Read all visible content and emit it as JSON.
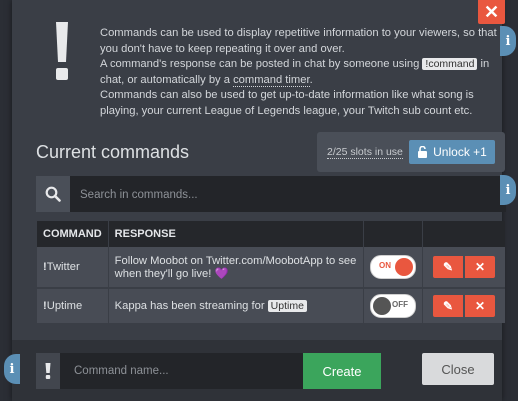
{
  "info": {
    "line1": "Commands can be used to display repetitive information to your viewers, so that you don't have to keep repeating it over and over.",
    "line2_pre": "A command's response can be posted in chat by someone using ",
    "line2_kbd": "!command",
    "line2_mid": " in chat, or automatically by a ",
    "line2_link": "command timer",
    "line2_post": ".",
    "line3": "Commands can also be used to get up-to-date information like what song is playing, your current League of Legends league, your Twitch sub count etc."
  },
  "heading": "Current commands",
  "slots": {
    "text": "2/25 slots in use",
    "unlock_label": "Unlock +1"
  },
  "search": {
    "placeholder": "Search in commands..."
  },
  "table": {
    "headers": {
      "command": "COMMAND",
      "response": "RESPONSE"
    },
    "rows": [
      {
        "prefix": "!",
        "name": "Twitter",
        "response": "Follow Moobot on Twitter.com/MoobotApp to see when they'll go live!",
        "emoji": "💜",
        "toggle": "ON"
      },
      {
        "prefix": "!",
        "name": "Uptime",
        "response_pre": "Kappa has been streaming for ",
        "response_tag": "Uptime",
        "toggle": "OFF"
      }
    ]
  },
  "footer": {
    "placeholder": "Command name...",
    "create_label": "Create",
    "close_label": "Close"
  },
  "colors": {
    "accent": "#e9573f",
    "blue": "#5b8fb5",
    "green": "#3ba55c"
  }
}
